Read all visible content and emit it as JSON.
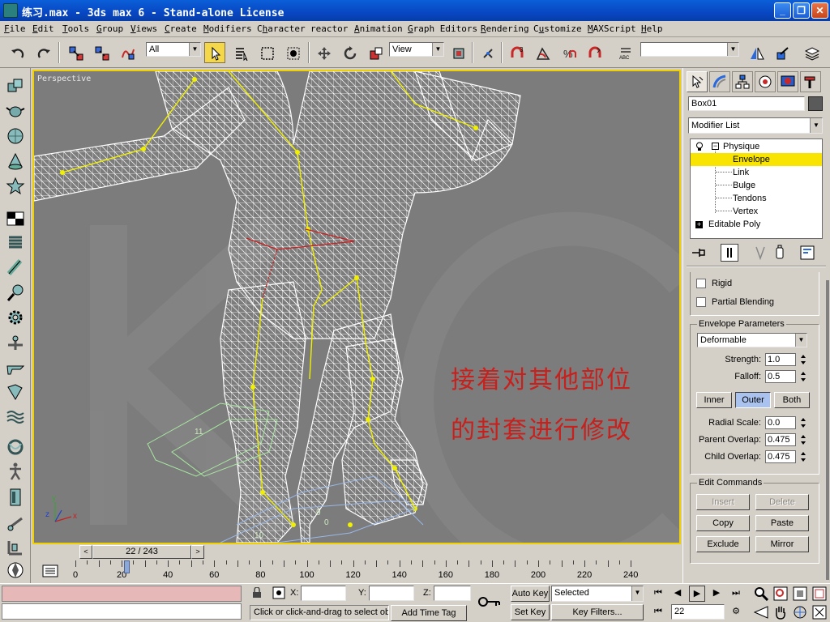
{
  "window": {
    "title": "练习.max - 3ds max 6 - Stand-alone License",
    "min_glyph": "_",
    "max_glyph": "❐",
    "close_glyph": "✕"
  },
  "menu": [
    {
      "label": "File",
      "key": "F"
    },
    {
      "label": "Edit",
      "key": "E"
    },
    {
      "label": "Tools",
      "key": "T"
    },
    {
      "label": "Group",
      "key": "G"
    },
    {
      "label": "Views",
      "key": "V"
    },
    {
      "label": "Create",
      "key": "C"
    },
    {
      "label": "Modifiers",
      "key": "M"
    },
    {
      "label": "Character",
      "key": "h"
    },
    {
      "label": "reactor",
      "key": ""
    },
    {
      "label": "Animation",
      "key": "A"
    },
    {
      "label": "Graph Editors",
      "key": "G"
    },
    {
      "label": "Rendering",
      "key": "R"
    },
    {
      "label": "Customize",
      "key": "u"
    },
    {
      "label": "MAXScript",
      "key": "M"
    },
    {
      "label": "Help",
      "key": "H"
    }
  ],
  "toolbar": {
    "selection_filter": "All",
    "reference_coord": "View",
    "named_selection": ""
  },
  "viewport": {
    "label": "Perspective",
    "overlay_line1": "接着对其他部位",
    "overlay_line2": "的封套进行修改",
    "frame_a": "11",
    "frame_b": "9",
    "frame_c": "0",
    "frame_d": "10",
    "axis_x": "x",
    "axis_y": "y",
    "axis_z": "z"
  },
  "command_panel": {
    "object_name": "Box01",
    "modifier_list": "Modifier List",
    "stack": [
      {
        "label": "Physique",
        "selected": false
      },
      {
        "label": "Envelope",
        "selected": true
      },
      {
        "label": "Link",
        "selected": false
      },
      {
        "label": "Bulge",
        "selected": false
      },
      {
        "label": "Tendons",
        "selected": false
      },
      {
        "label": "Vertex",
        "selected": false
      },
      {
        "label": "Editable Poly",
        "selected": false
      }
    ],
    "rigid_label": "Rigid",
    "partial_blending_label": "Partial Blending",
    "envelope_params_title": "Envelope Parameters",
    "envelope_type": "Deformable",
    "strength_label": "Strength:",
    "strength_value": "1.0",
    "falloff_label": "Falloff:",
    "falloff_value": "0.5",
    "inner_label": "Inner",
    "outer_label": "Outer",
    "both_label": "Both",
    "radial_scale_label": "Radial Scale:",
    "radial_scale_value": "0.0",
    "parent_overlap_label": "Parent Overlap:",
    "parent_overlap_value": "0.475",
    "child_overlap_label": "Child Overlap:",
    "child_overlap_value": "0.475",
    "edit_commands_title": "Edit Commands",
    "insert_label": "Insert",
    "delete_label": "Delete",
    "copy_label": "Copy",
    "paste_label": "Paste",
    "exclude_label": "Exclude",
    "mirror_label": "Mirror"
  },
  "timeline": {
    "slider_text": "22 / 243",
    "ticks": [
      "0",
      "20",
      "40",
      "60",
      "80",
      "100",
      "120",
      "140",
      "160",
      "180",
      "200",
      "220",
      "240"
    ],
    "current_frame": 22
  },
  "status": {
    "x_label": "X:",
    "y_label": "Y:",
    "z_label": "Z:",
    "prompt": "Click or click-and-drag to select obj",
    "add_time_tag": "Add Time Tag",
    "auto_key": "Auto Key",
    "set_key": "Set Key",
    "key_mode": "Selected",
    "key_filters": "Key Filters...",
    "frame_field": "22"
  }
}
